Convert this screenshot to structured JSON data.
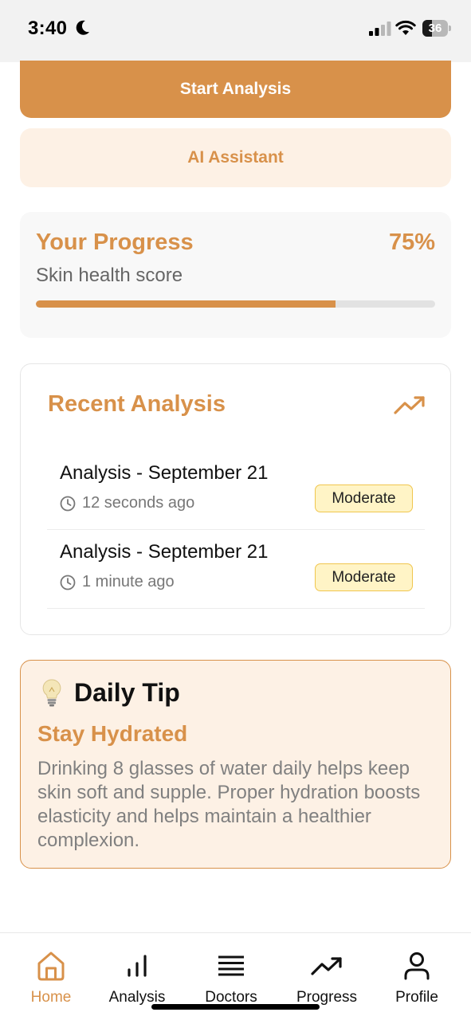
{
  "status_bar": {
    "time": "3:40",
    "battery_level": "36",
    "icons": [
      "moon-icon",
      "cellular-signal-icon",
      "wifi-icon",
      "battery-icon"
    ]
  },
  "actions": {
    "start_analysis_label": "Start Analysis",
    "ai_assistant_label": "AI Assistant"
  },
  "progress": {
    "title": "Your Progress",
    "percent_label": "75%",
    "subtitle": "Skin health score",
    "fraction": 0.75
  },
  "recent": {
    "title": "Recent Analysis",
    "icon": "trending-up-icon",
    "items": [
      {
        "title": "Analysis - September 21",
        "time": "12 seconds ago",
        "badge": "Moderate"
      },
      {
        "title": "Analysis - September 21",
        "time": "1 minute ago",
        "badge": "Moderate"
      }
    ]
  },
  "tip": {
    "icon": "lightbulb-icon",
    "heading": "Daily Tip",
    "title": "Stay Hydrated",
    "body": "Drinking 8 glasses of water daily helps keep skin soft and supple. Proper hydration boosts elasticity and helps maintain a healthier complexion."
  },
  "tabs": [
    {
      "label": "Home",
      "icon": "home-icon",
      "active": true
    },
    {
      "label": "Analysis",
      "icon": "bar-chart-icon",
      "active": false
    },
    {
      "label": "Doctors",
      "icon": "list-icon",
      "active": false
    },
    {
      "label": "Progress",
      "icon": "trending-up-icon",
      "active": false
    },
    {
      "label": "Profile",
      "icon": "person-icon",
      "active": false
    }
  ],
  "colors": {
    "accent": "#d8914a",
    "accent_light": "#fdf1e5",
    "badge_bg": "#fff4c6",
    "badge_border": "#f0c64e"
  }
}
